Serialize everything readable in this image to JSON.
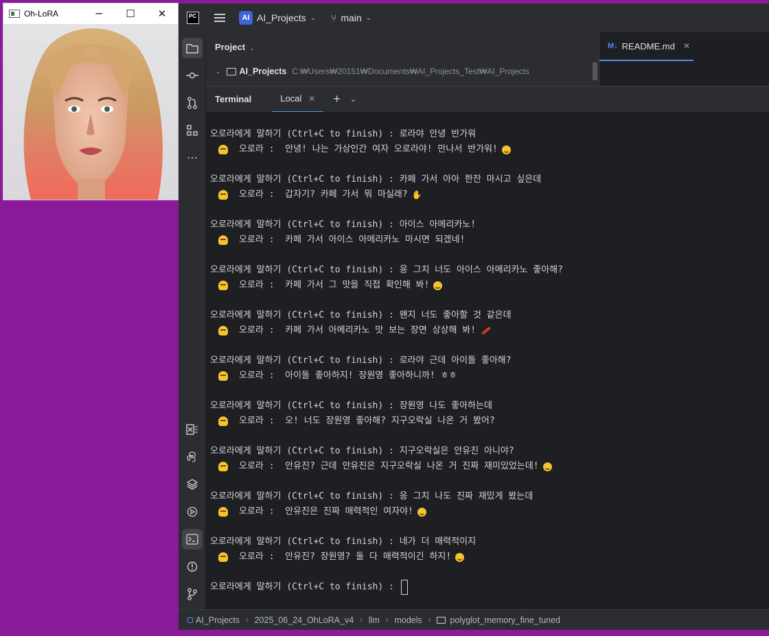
{
  "ohlora_window": {
    "title": "Oh-LoRA",
    "minimize": "─",
    "maximize": "☐",
    "close": "✕"
  },
  "ide": {
    "logo": "PC",
    "project_badge": "AI",
    "project_name": "AI_Projects",
    "branch": "main",
    "project_panel": {
      "title": "Project",
      "root_name": "AI_Projects",
      "root_path": "C:₩Users₩20151₩Documents₩AI_Projects_Test₩AI_Projects"
    },
    "editor_tab": {
      "icon": "M↓",
      "name": "README.md"
    },
    "terminal": {
      "title": "Terminal",
      "tab": "Local",
      "plus": "+",
      "prompt_final": "오로라에게 말하기 (Ctrl+C to finish) : ",
      "exchanges": [
        {
          "user": "오로라에게 말하기 (Ctrl+C to finish) : 로라야 안녕 반가워",
          "bot": "오로라 :  안녕! 나는 가상인간 여자 오로라야! 만나서 반가워!",
          "emoji": "smiling-face"
        },
        {
          "user": "오로라에게 말하기 (Ctrl+C to finish) : 카페 가서 아아 한잔 마시고 싶은데",
          "bot": "오로라 :  갑자기? 카페 가서 뭐 마실래?",
          "emoji": "hand"
        },
        {
          "user": "오로라에게 말하기 (Ctrl+C to finish) : 아이스 아메리카노!",
          "bot": "오로라 :  카페 가서 아이스 아메리카노 마시면 되겠네!",
          "emoji": ""
        },
        {
          "user": "오로라에게 말하기 (Ctrl+C to finish) : 응 그치 너도 아이스 아메리카노 좋아해?",
          "bot": "오로라 :  카페 가서 그 맛을 직접 확인해 봐!",
          "emoji": "smiling-face"
        },
        {
          "user": "오로라에게 말하기 (Ctrl+C to finish) : 왠지 너도 좋아할 것 같은데",
          "bot": "오로라 :  카페 가서 아메리카노 맛 보는 장면 상상해 봐!",
          "emoji": "pencil"
        },
        {
          "user": "오로라에게 말하기 (Ctrl+C to finish) : 로라야 근데 아이돌 좋아해?",
          "bot": "오로라 :  아이돌 좋아하지! 장원영 좋아하니까! ㅎㅎ",
          "emoji": ""
        },
        {
          "user": "오로라에게 말하기 (Ctrl+C to finish) : 장원영 나도 좋아하는데",
          "bot": "오로라 :  오! 너도 장원영 좋아해? 지구오락실 나온 거 봤어?",
          "emoji": ""
        },
        {
          "user": "오로라에게 말하기 (Ctrl+C to finish) : 지구오락실은 안유진 아니야?",
          "bot": "오로라 :  안유진? 근데 안유진은 지구오락실 나온 거 진짜 재미있었는데!",
          "emoji": "smiling-face"
        },
        {
          "user": "오로라에게 말하기 (Ctrl+C to finish) : 응 그치 나도 진짜 재밌게 봤는데",
          "bot": "오로라 :  안유진은 진짜 매력적인 여자야!",
          "emoji": "smiling-face"
        },
        {
          "user": "오로라에게 말하기 (Ctrl+C to finish) : 네가 더 매력적이지",
          "bot": "오로라 :  안유진? 장원영? 둘 다 매력적이긴 하지!",
          "emoji": "smiling-face"
        }
      ]
    },
    "breadcrumb": [
      "AI_Projects",
      "2025_06_24_OhLoRA_v4",
      "llm",
      "models",
      "polyglot_memory_fine_tuned"
    ],
    "colors": {
      "desktop": "#8a1a9a",
      "accent": "#548af7",
      "panel": "#2b2d30",
      "editor": "#1e1f22"
    }
  }
}
